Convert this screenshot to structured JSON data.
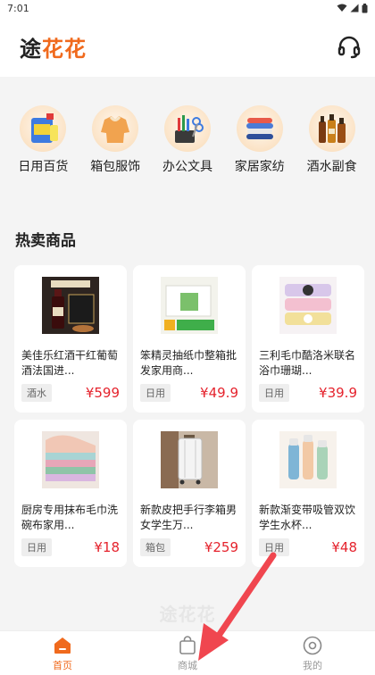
{
  "status": {
    "time": "7:01"
  },
  "header": {
    "logo": "途花花",
    "logo_part1": "途",
    "logo_part2": "花花"
  },
  "categories": [
    {
      "label": "日用百货",
      "icon": "detergent-icon"
    },
    {
      "label": "箱包服饰",
      "icon": "sweater-icon"
    },
    {
      "label": "办公文具",
      "icon": "stationery-icon"
    },
    {
      "label": "家居家纺",
      "icon": "towels-icon"
    },
    {
      "label": "酒水副食",
      "icon": "liquor-icon"
    }
  ],
  "section_title": "热卖商品",
  "products": [
    {
      "name": "美佳乐红酒干红葡萄酒法国进...",
      "tag": "酒水",
      "price": "¥599"
    },
    {
      "name": "笨精灵抽纸巾整箱批发家用商...",
      "tag": "日用",
      "price": "¥49.9"
    },
    {
      "name": "三利毛巾酷洛米联名浴巾珊瑚...",
      "tag": "日用",
      "price": "¥39.9"
    },
    {
      "name": "厨房专用抹布毛巾洗碗布家用...",
      "tag": "日用",
      "price": "¥18"
    },
    {
      "name": "新款皮把手行李箱男女学生万...",
      "tag": "箱包",
      "price": "¥259"
    },
    {
      "name": "新款渐变带吸管双饮学生水杯...",
      "tag": "日用",
      "price": "¥48"
    }
  ],
  "watermark": "途花花",
  "tabs": [
    {
      "label": "首页",
      "active": true
    },
    {
      "label": "商城",
      "active": false
    },
    {
      "label": "我的",
      "active": false
    }
  ],
  "colors": {
    "accent": "#f06a1d",
    "price": "#e5232d",
    "annotation_arrow": "#f0464f"
  }
}
